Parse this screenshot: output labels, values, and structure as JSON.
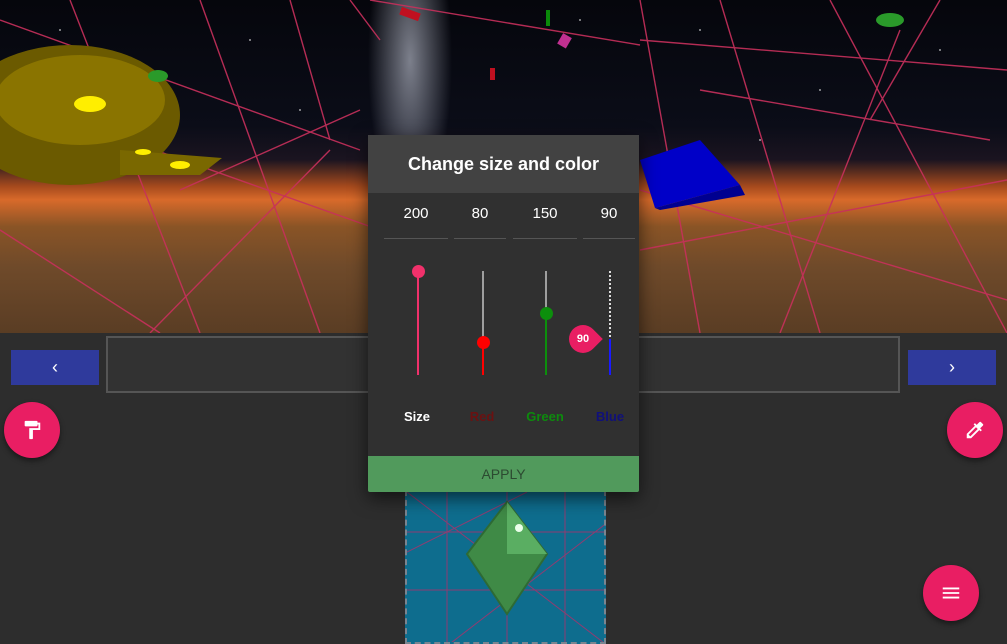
{
  "dialog": {
    "title": "Change size and color",
    "apply_label": "APPLY",
    "sliders": [
      {
        "label": "Size",
        "value": "200",
        "level": 1.0,
        "color": "#f0316b",
        "label_color": "#ffffff"
      },
      {
        "label": "Red",
        "value": "80",
        "level": 0.31,
        "color": "#ff0000",
        "label_color": "#6b1111"
      },
      {
        "label": "Green",
        "value": "150",
        "level": 0.59,
        "color": "#0c8f0c",
        "label_color": "#0d8a0d"
      },
      {
        "label": "Blue",
        "value": "90",
        "level": 0.35,
        "color": "#1a1aff",
        "label_color": "#10107a"
      }
    ],
    "active_value_bubble": "90"
  },
  "nav": {
    "prev_icon": "chevron-left-icon",
    "next_icon": "chevron-right-icon"
  },
  "fabs": {
    "left_icon": "paint-roller-icon",
    "right_icon": "eyedropper-icon",
    "menu_icon": "menu-icon"
  },
  "colors": {
    "accent": "#e91e63",
    "nav": "#2f3a9c",
    "apply": "#519a5c"
  }
}
